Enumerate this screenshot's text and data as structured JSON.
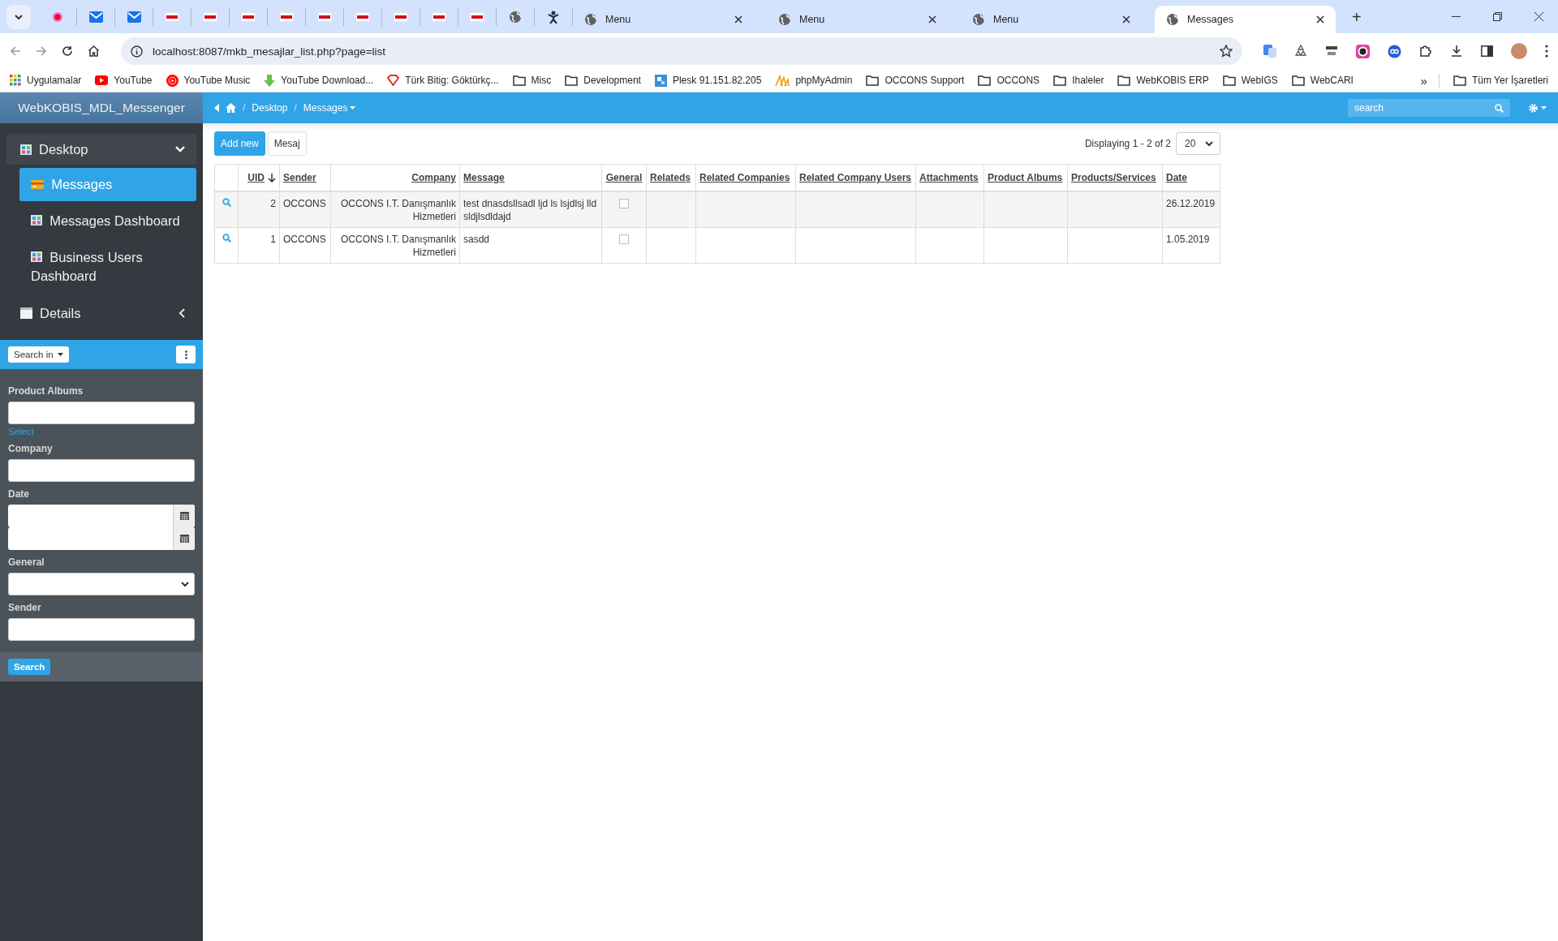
{
  "browser": {
    "tabs": [
      {
        "title": "Menu",
        "selected": false
      },
      {
        "title": "Menu",
        "selected": false
      },
      {
        "title": "Menu",
        "selected": false
      },
      {
        "title": "Messages",
        "selected": true
      }
    ],
    "new_tab": "+",
    "address": "localhost:8087/mkb_mesajlar_list.php?page=list",
    "bookmarks": [
      {
        "label": "Uygulamalar",
        "kind": "apps"
      },
      {
        "label": "YouTube",
        "kind": "youtube"
      },
      {
        "label": "YouTube Music",
        "kind": "music"
      },
      {
        "label": "YouTube Download...",
        "kind": "download"
      },
      {
        "label": "Türk Bitig: Göktürkç...",
        "kind": "gem"
      },
      {
        "label": "Misc",
        "kind": "folder"
      },
      {
        "label": "Development",
        "kind": "folder"
      },
      {
        "label": "Plesk 91.151.82.205",
        "kind": "plesk"
      },
      {
        "label": "phpMyAdmin",
        "kind": "pma"
      },
      {
        "label": "OCCONS Support",
        "kind": "folder"
      },
      {
        "label": "OCCONS",
        "kind": "folder"
      },
      {
        "label": "Ihaleler",
        "kind": "folder"
      },
      {
        "label": "WebKOBIS ERP",
        "kind": "folder"
      },
      {
        "label": "WebIGS",
        "kind": "folder"
      },
      {
        "label": "WebCARI",
        "kind": "folder"
      }
    ],
    "more": "»",
    "all_bookmarks": "Tüm Yer İşaretleri"
  },
  "app": {
    "brand": "WebKOBIS_MDL_Messenger",
    "breadcrumb": [
      {
        "separator": "/",
        "label": "Desktop",
        "dropdown": false
      },
      {
        "separator": "/",
        "label": "Messages",
        "dropdown": true
      }
    ],
    "search": {
      "placeholder": "search"
    }
  },
  "sidebar": {
    "menu": [
      {
        "label": "Desktop",
        "kind": "grid",
        "expanded": true,
        "children": [
          {
            "label": "Messages",
            "kind": "card",
            "selected": true
          },
          {
            "label": "Messages Dashboard",
            "kind": "grid",
            "selected": false
          },
          {
            "label": "Business Users Dashboard",
            "kind": "grid",
            "selected": false
          }
        ]
      },
      {
        "label": "Details",
        "kind": "page",
        "expanded": false
      }
    ],
    "search_in": "Search in",
    "filters": [
      {
        "label": "Product Albums",
        "kind": "text",
        "link": "Select"
      },
      {
        "label": "Company",
        "kind": "text"
      },
      {
        "label": "Date",
        "kind": "daterange"
      },
      {
        "label": "General",
        "kind": "select"
      },
      {
        "label": "Sender",
        "kind": "text"
      }
    ],
    "search_button": "Search"
  },
  "toolbar": {
    "buttons": [
      {
        "label": "Add new",
        "primary": true
      },
      {
        "label": "Mesaj",
        "primary": false
      }
    ],
    "pagination": "Displaying 1 - 2 of 2",
    "page_size": "20"
  },
  "table": {
    "columns": [
      {
        "label": "UID",
        "sorted": true
      },
      {
        "label": "Sender",
        "sorted": false
      },
      {
        "label": "Company",
        "sorted": false
      },
      {
        "label": "Message",
        "sorted": false
      },
      {
        "label": "General",
        "sorted": false
      },
      {
        "label": "Relateds",
        "sorted": false
      },
      {
        "label": "Related Companies",
        "sorted": false
      },
      {
        "label": "Related Company Users",
        "sorted": false
      },
      {
        "label": "Attachments",
        "sorted": false
      },
      {
        "label": "Product Albums",
        "sorted": false
      },
      {
        "label": "Products/Services",
        "sorted": false
      },
      {
        "label": "Date",
        "sorted": false
      }
    ],
    "rows": [
      {
        "cells": [
          "2",
          "OCCONS",
          "OCCONS I.T. Danışmanlık Hizmetleri",
          "test dnasdsllsadl ljd ls lsjdlsj lld sldjlsdldajd",
          false,
          null,
          null,
          null,
          null,
          null,
          null,
          "26.12.2019"
        ]
      },
      {
        "cells": [
          "1",
          "OCCONS",
          "OCCONS I.T. Danışmanlık Hizmetleri",
          "sasdd",
          false,
          null,
          null,
          null,
          null,
          null,
          null,
          "1.05.2019"
        ]
      }
    ]
  }
}
